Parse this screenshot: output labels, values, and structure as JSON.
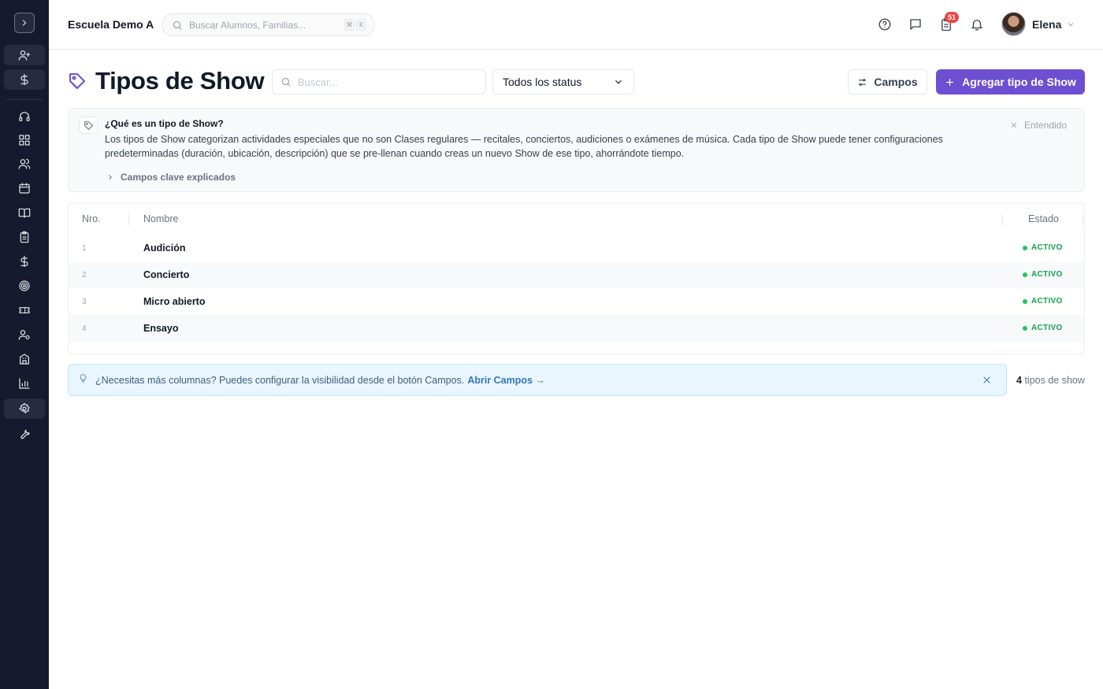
{
  "sidebar": {
    "toggle_icon": "chevron-right-icon",
    "items": [
      {
        "name": "sidebar-item-add-student",
        "icon": "user-plus-icon"
      },
      {
        "name": "sidebar-item-billing",
        "icon": "dollar-icon"
      },
      {
        "name": "sidebar-item-support",
        "icon": "headset-icon"
      },
      {
        "name": "sidebar-item-dashboard",
        "icon": "grid-icon"
      },
      {
        "name": "sidebar-item-people",
        "icon": "users-icon"
      },
      {
        "name": "sidebar-item-calendar",
        "icon": "calendar-icon"
      },
      {
        "name": "sidebar-item-lessons",
        "icon": "book-icon"
      },
      {
        "name": "sidebar-item-tasks",
        "icon": "clipboard-icon"
      },
      {
        "name": "sidebar-item-payments",
        "icon": "dollar-icon"
      },
      {
        "name": "sidebar-item-goals",
        "icon": "target-icon"
      },
      {
        "name": "sidebar-item-tickets",
        "icon": "ticket-icon"
      },
      {
        "name": "sidebar-item-staff",
        "icon": "user-gear-icon"
      },
      {
        "name": "sidebar-item-locations",
        "icon": "building-icon"
      },
      {
        "name": "sidebar-item-reports",
        "icon": "bar-chart-icon"
      },
      {
        "name": "sidebar-item-settings",
        "icon": "gear-icon"
      },
      {
        "name": "sidebar-item-tools",
        "icon": "wrench-icon"
      }
    ]
  },
  "topbar": {
    "school_name": "Escuela Demo A",
    "search_placeholder": "Buscar Alumnos, Familias...",
    "shortcut_keys": [
      "⌘",
      "K"
    ],
    "notification_count": "51",
    "user_name": "Elena"
  },
  "page": {
    "title": "Tipos de Show",
    "search_placeholder": "Buscar...",
    "status_filter": "Todos los status",
    "fields_button": "Campos",
    "add_button": "Agregar tipo de Show"
  },
  "info": {
    "title": "¿Qué es un tipo de Show?",
    "text": "Los tipos de Show categorizan actividades especiales que no son Clases regulares — recitales, conciertos, audiciones o exámenes de música. Cada tipo de Show puede tener configuraciones predeterminadas (duración, ubicación, descripción) que se pre-llenan cuando creas un nuevo Show de ese tipo, ahorrándote tiempo.",
    "dismiss_label": "Entendido",
    "expand_label": "Campos clave explicados"
  },
  "table": {
    "columns": [
      "Nro.",
      "Nombre",
      "Estado"
    ],
    "rows": [
      {
        "num": "1",
        "name": "Audición",
        "status": "ACTIVO"
      },
      {
        "num": "2",
        "name": "Concierto",
        "status": "ACTIVO"
      },
      {
        "num": "3",
        "name": "Micro abierto",
        "status": "ACTIVO"
      },
      {
        "num": "4",
        "name": "Ensayo",
        "status": "ACTIVO"
      }
    ]
  },
  "tip": {
    "text": "¿Necesitas más columnas? Puedes configurar la visibilidad desde el botón Campos.",
    "link": "Abrir Campos →"
  },
  "footer": {
    "count": "4",
    "count_label": "tipos de show"
  },
  "colors": {
    "sidebar_bg": "#161a2e",
    "accent": "#6d4fd1",
    "active_status": "#16a34a",
    "badge_red": "#ef4444",
    "tip_link": "#3478b6"
  }
}
